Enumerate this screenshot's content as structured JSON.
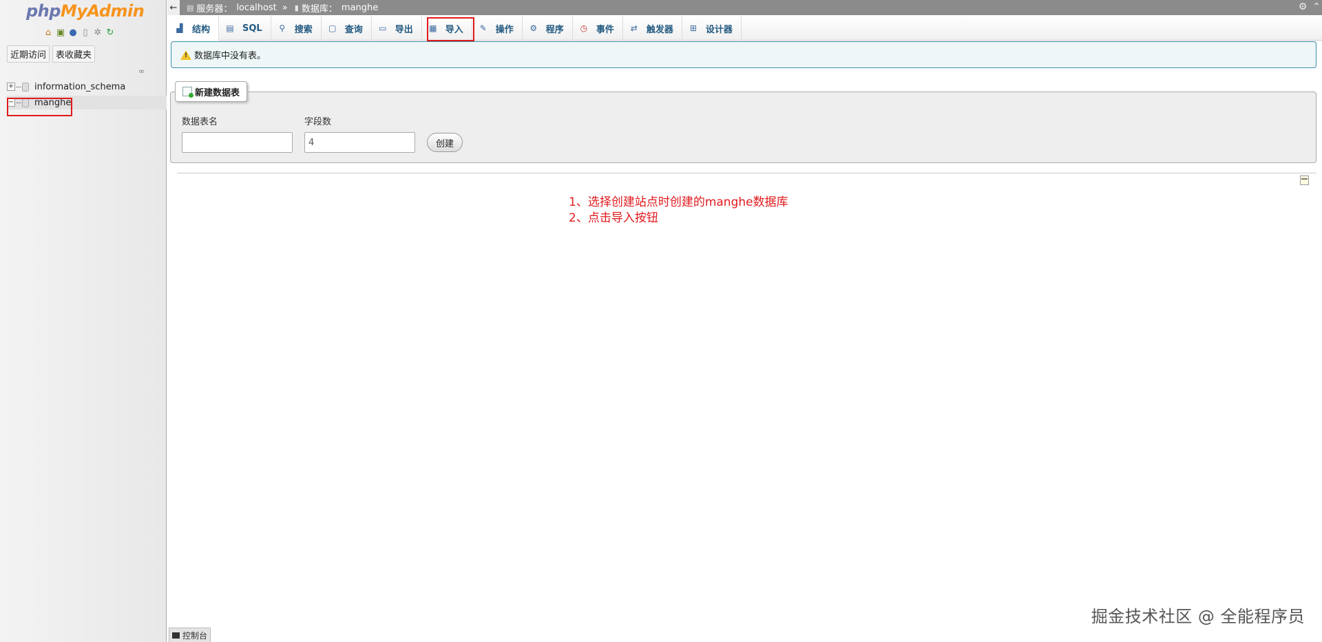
{
  "nav": {
    "logo_php": "php",
    "logo_my": "My",
    "logo_admin": "Admin",
    "icons": [
      "home-icon",
      "exit-icon",
      "help-icon",
      "docs-icon",
      "settings-icon",
      "reload-icon"
    ],
    "tab_recent": "近期访问",
    "tab_favorites": "表收藏夹",
    "databases": [
      {
        "name": "information_schema"
      },
      {
        "name": "manghe"
      }
    ]
  },
  "breadcrumb": {
    "server_label": "服务器：",
    "server_value": "localhost",
    "separator": "»",
    "database_label": "数据库：",
    "database_value": "manghe"
  },
  "tabs": [
    {
      "label": "结构",
      "icon": "structure-icon"
    },
    {
      "label": "SQL",
      "icon": "sql-icon"
    },
    {
      "label": "搜索",
      "icon": "search-icon"
    },
    {
      "label": "查询",
      "icon": "query-icon"
    },
    {
      "label": "导出",
      "icon": "export-icon"
    },
    {
      "label": "导入",
      "icon": "import-icon"
    },
    {
      "label": "操作",
      "icon": "operations-icon"
    },
    {
      "label": "程序",
      "icon": "routines-icon"
    },
    {
      "label": "事件",
      "icon": "events-icon"
    },
    {
      "label": "触发器",
      "icon": "triggers-icon"
    },
    {
      "label": "设计器",
      "icon": "designer-icon"
    }
  ],
  "notice": {
    "message": "数据库中没有表。"
  },
  "create_table": {
    "legend": "新建数据表",
    "name_label": "数据表名",
    "name_value": "",
    "columns_label": "字段数",
    "columns_value": "4",
    "button_label": "创建"
  },
  "annotations": {
    "line1": "1、选择创建站点时创建的manghe数据库",
    "line2": "2、点击导入按钮"
  },
  "console_label": "控制台",
  "watermark": "掘金技术社区 @ 全能程序员",
  "colors": {
    "highlight_red": "#e0191d",
    "tab_text": "#235a81",
    "topbar": "#8b8b8b",
    "notice_border": "#3b8fa9"
  }
}
